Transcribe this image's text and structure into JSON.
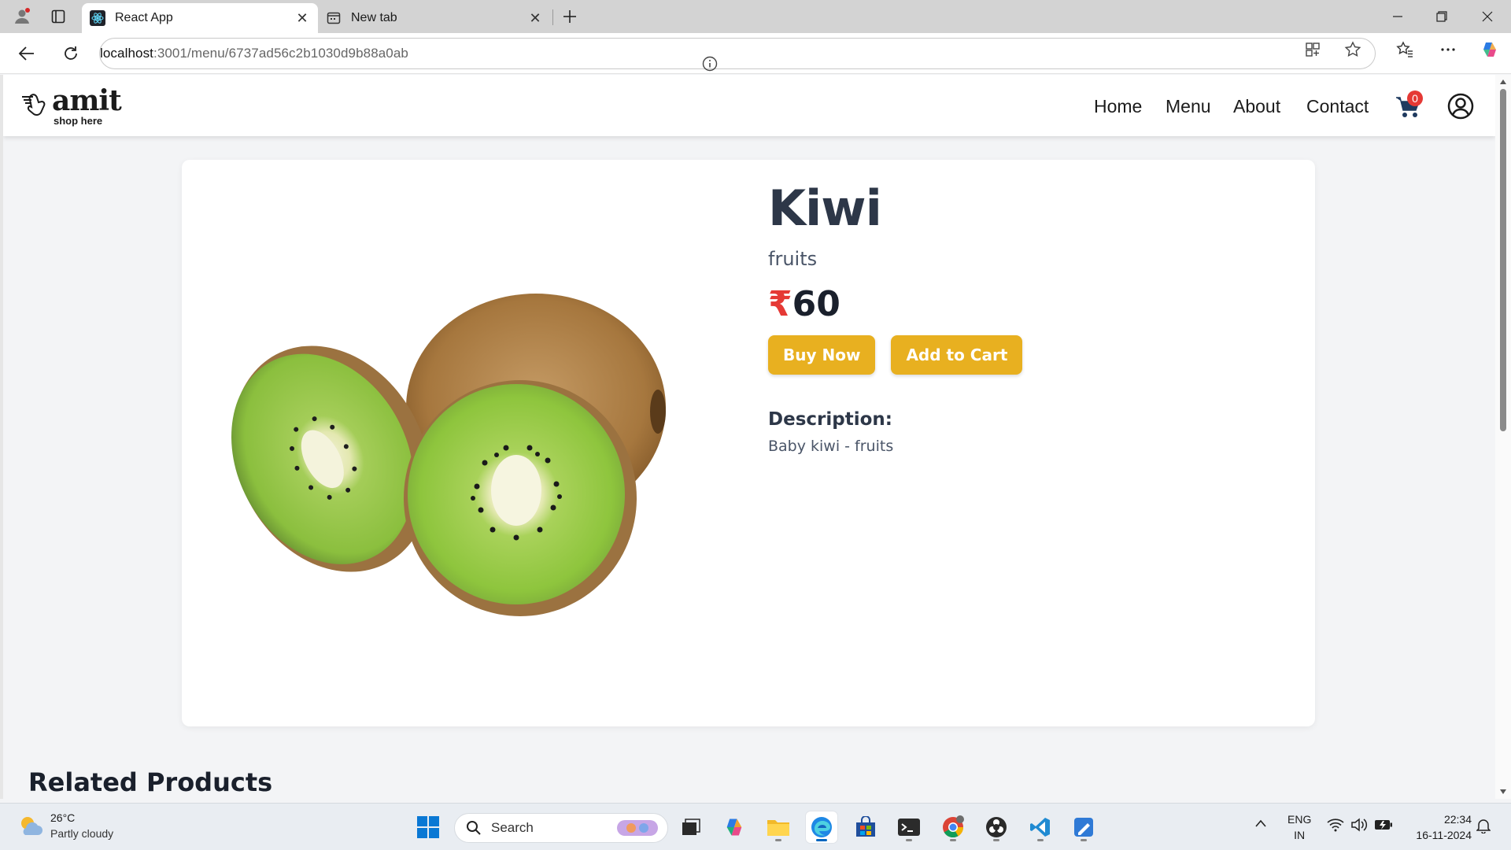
{
  "browser": {
    "tabs": [
      {
        "label": "React App",
        "active": true
      },
      {
        "label": "New tab",
        "active": false
      }
    ],
    "url_host": "localhost",
    "url_rest": ":3001/menu/6737ad56c2b1030d9b88a0ab"
  },
  "site": {
    "logo_text": "amit",
    "logo_subtext": "shop here",
    "nav": [
      {
        "label": "Home"
      },
      {
        "label": "Menu"
      },
      {
        "label": "About"
      },
      {
        "label": "Contact"
      }
    ],
    "cart_count": "0"
  },
  "product": {
    "name": "Kiwi",
    "category": "fruits",
    "currency": "₹",
    "price": "60",
    "buy_label": "Buy Now",
    "add_label": "Add to Cart",
    "description_title": "Description:",
    "description": "Baby kiwi - fruits"
  },
  "related_title": "Related Products",
  "taskbar": {
    "weather_temp": "26°C",
    "weather_cond": "Partly cloudy",
    "search_label": "Search",
    "lang_1": "ENG",
    "lang_2": "IN",
    "time": "22:34",
    "date": "16-11-2024"
  },
  "colors": {
    "accent_button": "#e8b020",
    "price_currency": "#e53935",
    "cart_badge": "#e53935"
  }
}
